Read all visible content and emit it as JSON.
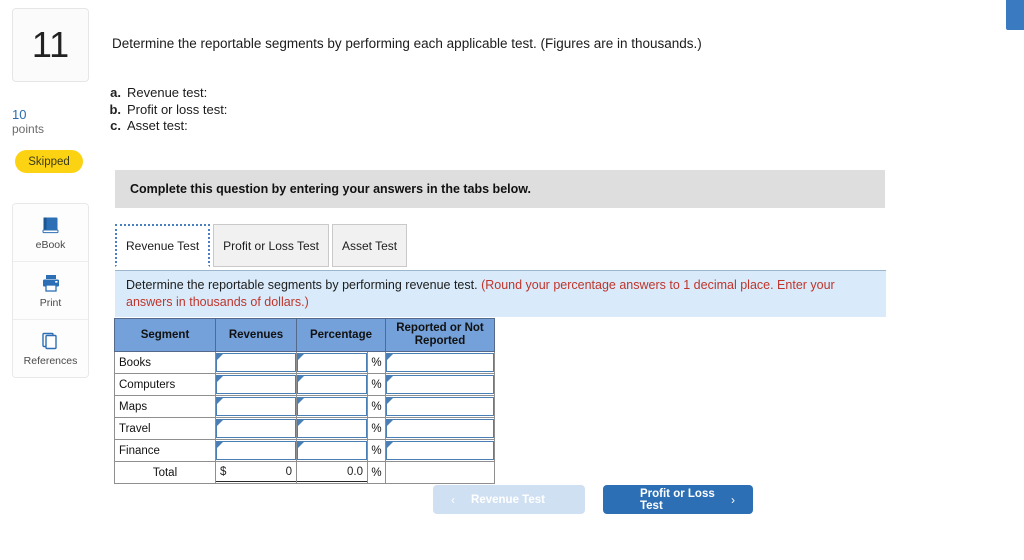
{
  "question": {
    "number": "11",
    "points_value": "10",
    "points_label": "points",
    "status_badge": "Skipped"
  },
  "tools": [
    {
      "label": "eBook",
      "icon": "book-icon"
    },
    {
      "label": "Print",
      "icon": "printer-icon"
    },
    {
      "label": "References",
      "icon": "references-icon"
    }
  ],
  "prompt": "Determine the reportable segments by performing each applicable test. (Figures are in thousands.)",
  "sub_items": [
    {
      "key": "a.",
      "text": "Revenue test:"
    },
    {
      "key": "b.",
      "text": "Profit or loss test:"
    },
    {
      "key": "c.",
      "text": "Asset test:"
    }
  ],
  "banner": {
    "text": "Complete this question by entering your answers in the tabs below."
  },
  "tabs": [
    {
      "label": "Revenue Test",
      "active": true
    },
    {
      "label": "Profit or Loss Test",
      "active": false
    },
    {
      "label": "Asset Test",
      "active": false
    }
  ],
  "instruction": {
    "black": "Determine the reportable segments by performing revenue test.",
    "red": "(Round your percentage answers to 1 decimal place. Enter your answers in thousands of dollars.)"
  },
  "table": {
    "headers": [
      "Segment",
      "Revenues",
      "Percentage",
      "Reported or Not Reported"
    ],
    "rows": [
      {
        "segment": "Books",
        "revenue": "",
        "percentage": "",
        "pct_symbol": "%",
        "reported": ""
      },
      {
        "segment": "Computers",
        "revenue": "",
        "percentage": "",
        "pct_symbol": "%",
        "reported": ""
      },
      {
        "segment": "Maps",
        "revenue": "",
        "percentage": "",
        "pct_symbol": "%",
        "reported": ""
      },
      {
        "segment": "Travel",
        "revenue": "",
        "percentage": "",
        "pct_symbol": "%",
        "reported": ""
      },
      {
        "segment": "Finance",
        "revenue": "",
        "percentage": "",
        "pct_symbol": "%",
        "reported": ""
      }
    ],
    "total": {
      "label": "Total",
      "currency": "$",
      "revenue": "0",
      "percentage": "0.0",
      "pct_symbol": "%"
    }
  },
  "nav": {
    "prev_label": "Revenue Test",
    "prev_chevron": "‹",
    "next_label": "Profit or Loss Test",
    "next_chevron": "›"
  },
  "colors": {
    "accent_blue": "#2c6fb5",
    "table_header_blue": "#74a1d9",
    "instruction_bg": "#d9ebfa",
    "banner_gray": "#dedede",
    "badge_yellow": "#fcd313",
    "red_text": "#c0342b"
  }
}
